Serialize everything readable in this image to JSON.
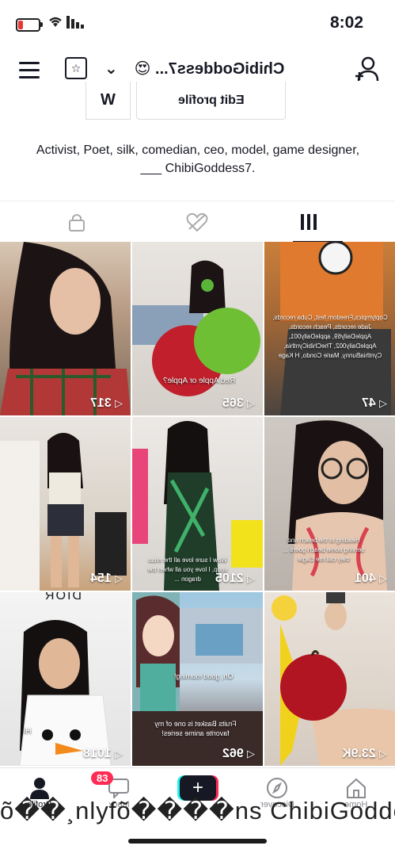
{
  "status_bar": {
    "time": "8:02"
  },
  "header": {
    "username": "ChibiGoddess7...",
    "emoji": "😍"
  },
  "profile": {
    "edit_label": "Edit profile",
    "bookmark_glyph": "W",
    "bio": "Activist, Poet, silk, comedian, ceo, model, game designer, ___ ChibiGoddess7."
  },
  "videos": [
    {
      "views": "317",
      "caption": ""
    },
    {
      "views": "365",
      "caption": "Red Apple or Apple?"
    },
    {
      "views": "47",
      "caption": "Coplympics,Freedom fest, Cuba records, Jade records, Peach records, AppleDaily69, appleDaily001, AppleDaily002, TheChibiCynthia, CynthiaBunny, Marie Condo, H Kage"
    },
    {
      "views": "154",
      "caption": ""
    },
    {
      "views": "2105",
      "caption": "Wow I sure love all the miso soup, I love you all when the dragon ..."
    },
    {
      "views": "401",
      "caption": "Heading to the beach and serving some beach goers ... they call me Eagle"
    },
    {
      "views": "1018",
      "caption": "Hi"
    },
    {
      "views": "962",
      "caption": "Fruits Basket is one of my favorite anime series!"
    },
    {
      "views": "23.9K",
      "caption": ""
    }
  ],
  "grid_caption_extra": {
    "anime_dialog": "Oh, good morning!",
    "dior": "DIOR"
  },
  "nav": {
    "profile": "Profile",
    "inbox": "Inbox",
    "inbox_badge": "83",
    "discover": "Discover",
    "home": "Home"
  },
  "overlay_marquee": "õ��¸nlyfõ����ns ChibiGodde"
}
